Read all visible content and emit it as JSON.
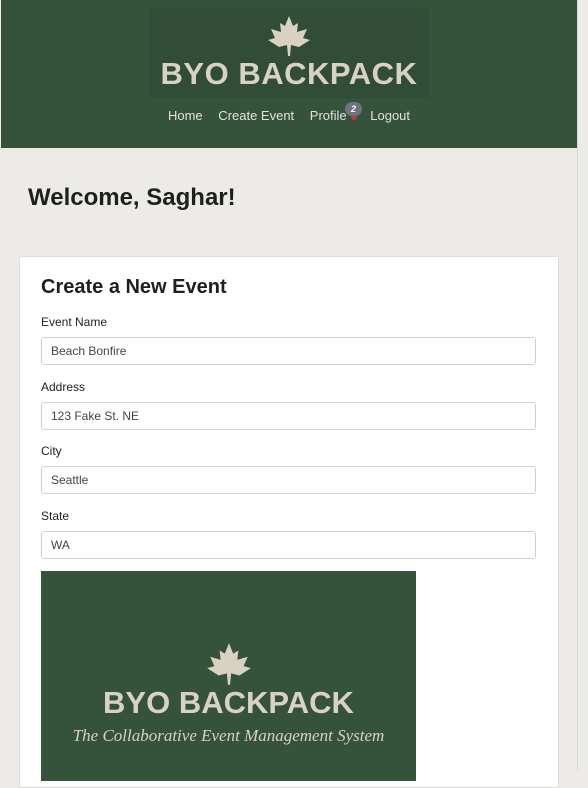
{
  "header": {
    "logo_text": "BYO BACKPACK",
    "nav": {
      "home": "Home",
      "create_event": "Create Event",
      "profile": "Profile",
      "logout": "Logout",
      "notification_count": "2"
    }
  },
  "welcome": "Welcome, Saghar!",
  "form": {
    "title": "Create a New Event",
    "fields": [
      {
        "label": "Event Name",
        "value": "Beach Bonfire"
      },
      {
        "label": "Address",
        "value": "123 Fake St. NE"
      },
      {
        "label": "City",
        "value": "Seattle"
      },
      {
        "label": "State",
        "value": "WA"
      }
    ]
  },
  "banner": {
    "title": "BYO BACKPACK",
    "subtitle": "The Collaborative Event Management System"
  },
  "colors": {
    "header_bg": "#35523a",
    "logo_text": "#d9d2c2",
    "page_bg": "#ecebe7",
    "notification_dot": "#c8353c",
    "badge_bg": "#6c747d"
  },
  "icons": {
    "logo": "maple-leaf-icon"
  }
}
